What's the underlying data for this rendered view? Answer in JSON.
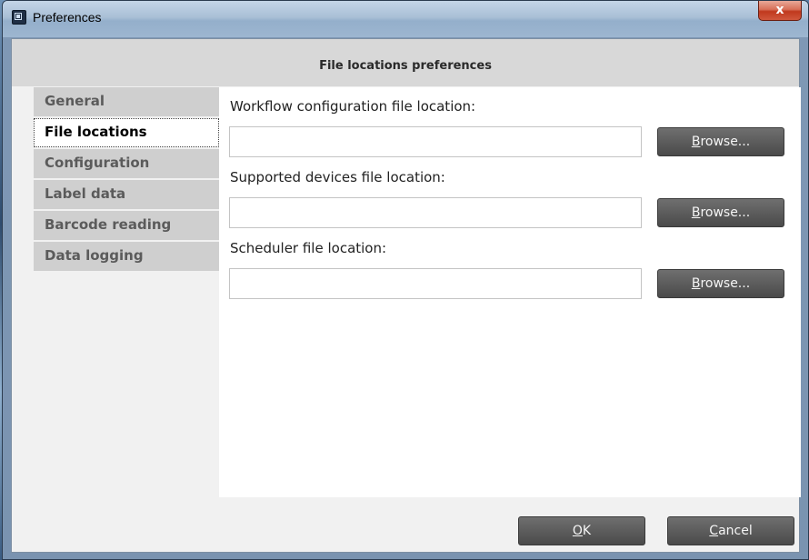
{
  "window": {
    "title": "Preferences",
    "close_glyph": "x",
    "icon": "app-window-icon"
  },
  "header": {
    "title": "File locations preferences"
  },
  "sidebar": {
    "items": [
      {
        "label": "General",
        "active": false
      },
      {
        "label": "File locations",
        "active": true
      },
      {
        "label": "Configuration",
        "active": false
      },
      {
        "label": "Label data",
        "active": false
      },
      {
        "label": "Barcode reading",
        "active": false
      },
      {
        "label": "Data logging",
        "active": false
      }
    ]
  },
  "fields": [
    {
      "label": "Workflow configuration file location:",
      "value": "",
      "browse_mnemonic": "B",
      "browse_rest": "rowse..."
    },
    {
      "label": "Supported devices file location:",
      "value": "",
      "browse_mnemonic": "B",
      "browse_rest": "rowse..."
    },
    {
      "label": "Scheduler file location:",
      "value": "",
      "browse_mnemonic": "B",
      "browse_rest": "rowse..."
    }
  ],
  "footer": {
    "ok_mnemonic": "O",
    "ok_rest": "K",
    "cancel_mnemonic": "C",
    "cancel_rest": "ancel"
  },
  "colors": {
    "button_bg": "#4a4a4a",
    "sidebar_inactive": "#cfcfcf",
    "header_bg": "#d8d8d8",
    "close_button": "#c0391e"
  }
}
